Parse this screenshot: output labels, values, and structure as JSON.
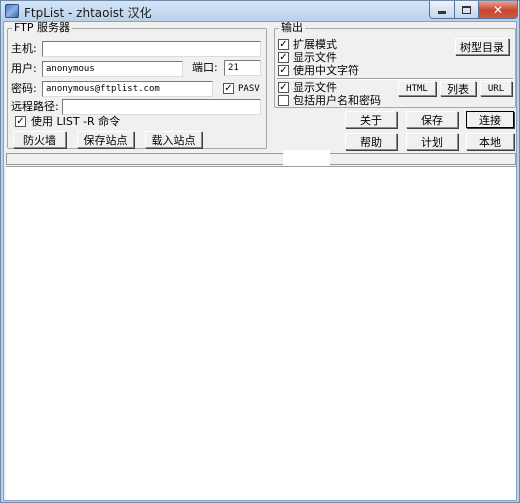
{
  "window": {
    "title": "FtpList - zhtaoist 汉化",
    "close_glyph": "✕"
  },
  "server": {
    "legend": "FTP 服务器",
    "host_label": "主机:",
    "host_value": "",
    "user_label": "用户:",
    "user_value": "anonymous",
    "port_label": "端口:",
    "port_value": "21",
    "pass_label": "密码:",
    "pass_value": "anonymous@ftplist.com",
    "pasv_label": "PASV",
    "pasv_checked": true,
    "path_label": "远程路径:",
    "path_value": "",
    "list_r_label": "使用 LIST -R 命令",
    "list_r_checked": true,
    "firewall_button": "防火墙",
    "save_site_button": "保存站点",
    "load_site_button": "载入站点"
  },
  "output": {
    "legend": "输出",
    "expand_label": "扩展模式",
    "expand_checked": true,
    "show_files_label": "显示文件",
    "show_files_checked": true,
    "chinese_label": "使用中文字符",
    "chinese_checked": true,
    "show_files2_label": "显示文件",
    "show_files2_checked": true,
    "include_user_label": "包括用户名和密码",
    "include_user_checked": false,
    "tree_button": "树型目录",
    "html_button": "HTML",
    "list_button": "列表",
    "url_button": "URL"
  },
  "actions": {
    "about": "关于",
    "save": "保存",
    "connect": "连接",
    "help": "帮助",
    "schedule": "计划",
    "local": "本地"
  },
  "check_glyph": "✓"
}
